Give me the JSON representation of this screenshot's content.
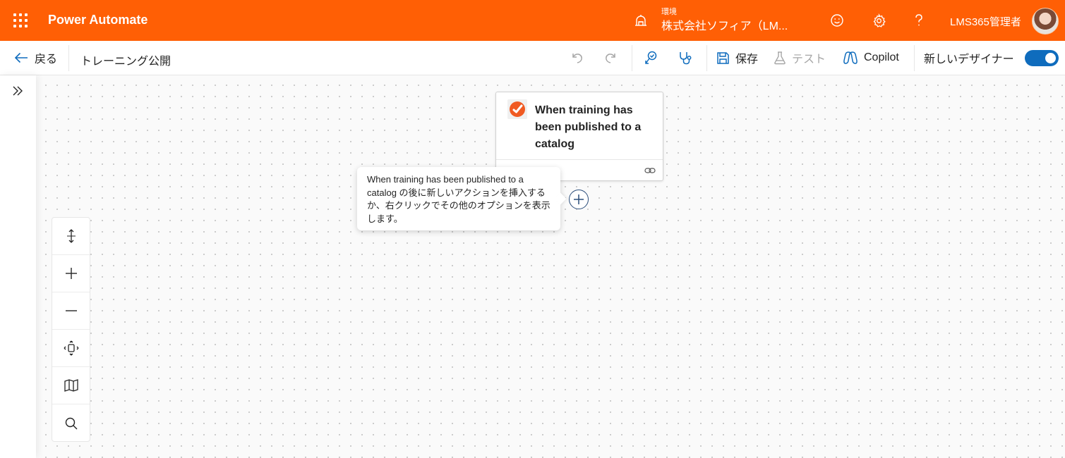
{
  "header": {
    "app_title": "Power Automate",
    "environment_label": "環境",
    "environment_name": "株式会社ソフィア（LM...",
    "user_name": "LMS365管理者",
    "accent_color": "#ff5f05"
  },
  "commandbar": {
    "back_label": "戻る",
    "flow_title": "トレーニング公開",
    "save_label": "保存",
    "test_label": "テスト",
    "copilot_label": "Copilot",
    "new_designer_label": "新しいデザイナー",
    "new_designer_enabled": true
  },
  "icons": [
    "app-launcher-icon",
    "environment-icon",
    "smiley-icon",
    "gear-icon",
    "help-icon",
    "back-arrow-icon",
    "undo-icon",
    "redo-icon",
    "flow-checker-icon",
    "stethoscope-icon",
    "save-icon",
    "beaker-icon",
    "copilot-icon",
    "chevron-double-right-icon",
    "fit-vertical-icon",
    "zoom-in-icon",
    "zoom-out-icon",
    "fit-view-icon",
    "minimap-icon",
    "search-icon",
    "link-icon",
    "plus-icon"
  ],
  "canvas": {
    "trigger_card": {
      "title": "When training has been published to a catalog",
      "brand_color": "#f05a22"
    },
    "tooltip_text": "When training has been published to a catalog の後に新しいアクションを挿入するか、右クリックでその他のオプションを表示します。"
  }
}
